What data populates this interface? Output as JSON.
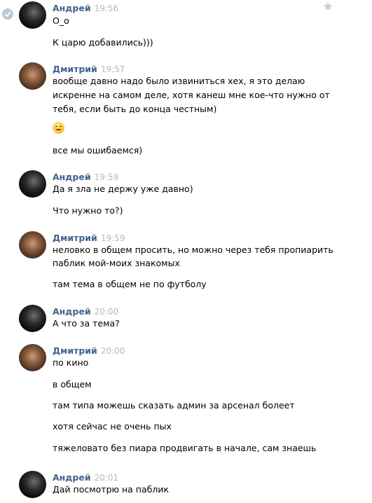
{
  "groups": [
    {
      "author": "Андрей",
      "time": "19:56",
      "lines": [
        "О_о",
        "К царю добавились)))"
      ]
    },
    {
      "author": "Дмитрий",
      "time": "19:57",
      "lines": [
        "вообще давно надо было извиниться хех, я это делаю",
        "искренне на самом деле, хотя канеш мне кое-что нужно от",
        "тебя, если быть до конца честным)",
        "все мы ошибаемся)"
      ],
      "emoji": "smiling-face-icon"
    },
    {
      "author": "Андрей",
      "time": "19:59",
      "lines": [
        "Да я зла не держу уже давно)",
        "Что нужно то?)"
      ]
    },
    {
      "author": "Дмитрий",
      "time": "19:59",
      "lines": [
        "неловко в общем просить, но можно через тебя пропиарить",
        "паблик мой-моих знакомых",
        "там тема в общем не по футболу"
      ]
    },
    {
      "author": "Андрей",
      "time": "20:00",
      "lines": [
        "А что за тема?"
      ]
    },
    {
      "author": "Дмитрий",
      "time": "20:00",
      "lines": [
        "по кино",
        "в общем",
        "там типа можешь сказать админ за арсенал болеет",
        "хотя сейчас не очень пых",
        "тяжеловато без пиара продвигать в начале, сам знаешь"
      ]
    },
    {
      "author": "Андрей",
      "time": "20:01",
      "lines": [
        "Дай посмотрю на паблик"
      ]
    }
  ],
  "colors": {
    "author": "#42648b",
    "time": "#b3b9c1",
    "text": "#000000",
    "check": "#bcc8d6",
    "star": "#c5d0db"
  }
}
